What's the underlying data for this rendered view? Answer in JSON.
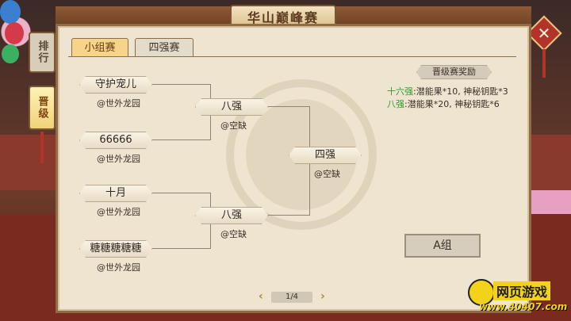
{
  "header": {
    "title": "华山巅峰赛",
    "close_symbol": "✕"
  },
  "side_tabs": [
    {
      "label": "排行",
      "active": false
    },
    {
      "label": "晋级",
      "active": true
    }
  ],
  "tabs": [
    {
      "label": "小组赛",
      "active": true
    },
    {
      "label": "四强赛",
      "active": false
    }
  ],
  "bracket": {
    "round1": [
      {
        "name": "守护宠儿",
        "guild": "@世外龙园"
      },
      {
        "name": "66666",
        "guild": "@世外龙园"
      },
      {
        "name": "十月",
        "guild": "@世外龙园"
      },
      {
        "name": "糖糖糖糖糖",
        "guild": "@世外龙园"
      }
    ],
    "round2": [
      {
        "name": "八强",
        "guild": "@空缺"
      },
      {
        "name": "八强",
        "guild": "@空缺"
      }
    ],
    "round3": {
      "name": "四强",
      "guild": "@空缺"
    }
  },
  "rewards": {
    "title": "晋级赛奖励",
    "lines": [
      {
        "tier": "十六强",
        "text": ":潜能果*10, 神秘钥匙*3"
      },
      {
        "tier": "八强",
        "text": ":潜能果*20, 神秘钥匙*6"
      }
    ]
  },
  "group_button": "A组",
  "pager": {
    "text": "1/4",
    "prev": "‹",
    "next": "›"
  },
  "watermark": {
    "text": "网页游戏",
    "url": "www.40407.com"
  },
  "colors": {
    "accent": "#f6d58a",
    "frame": "#8d6c47",
    "tier_green": "#2f9a2f",
    "close_red": "#b3322a"
  }
}
